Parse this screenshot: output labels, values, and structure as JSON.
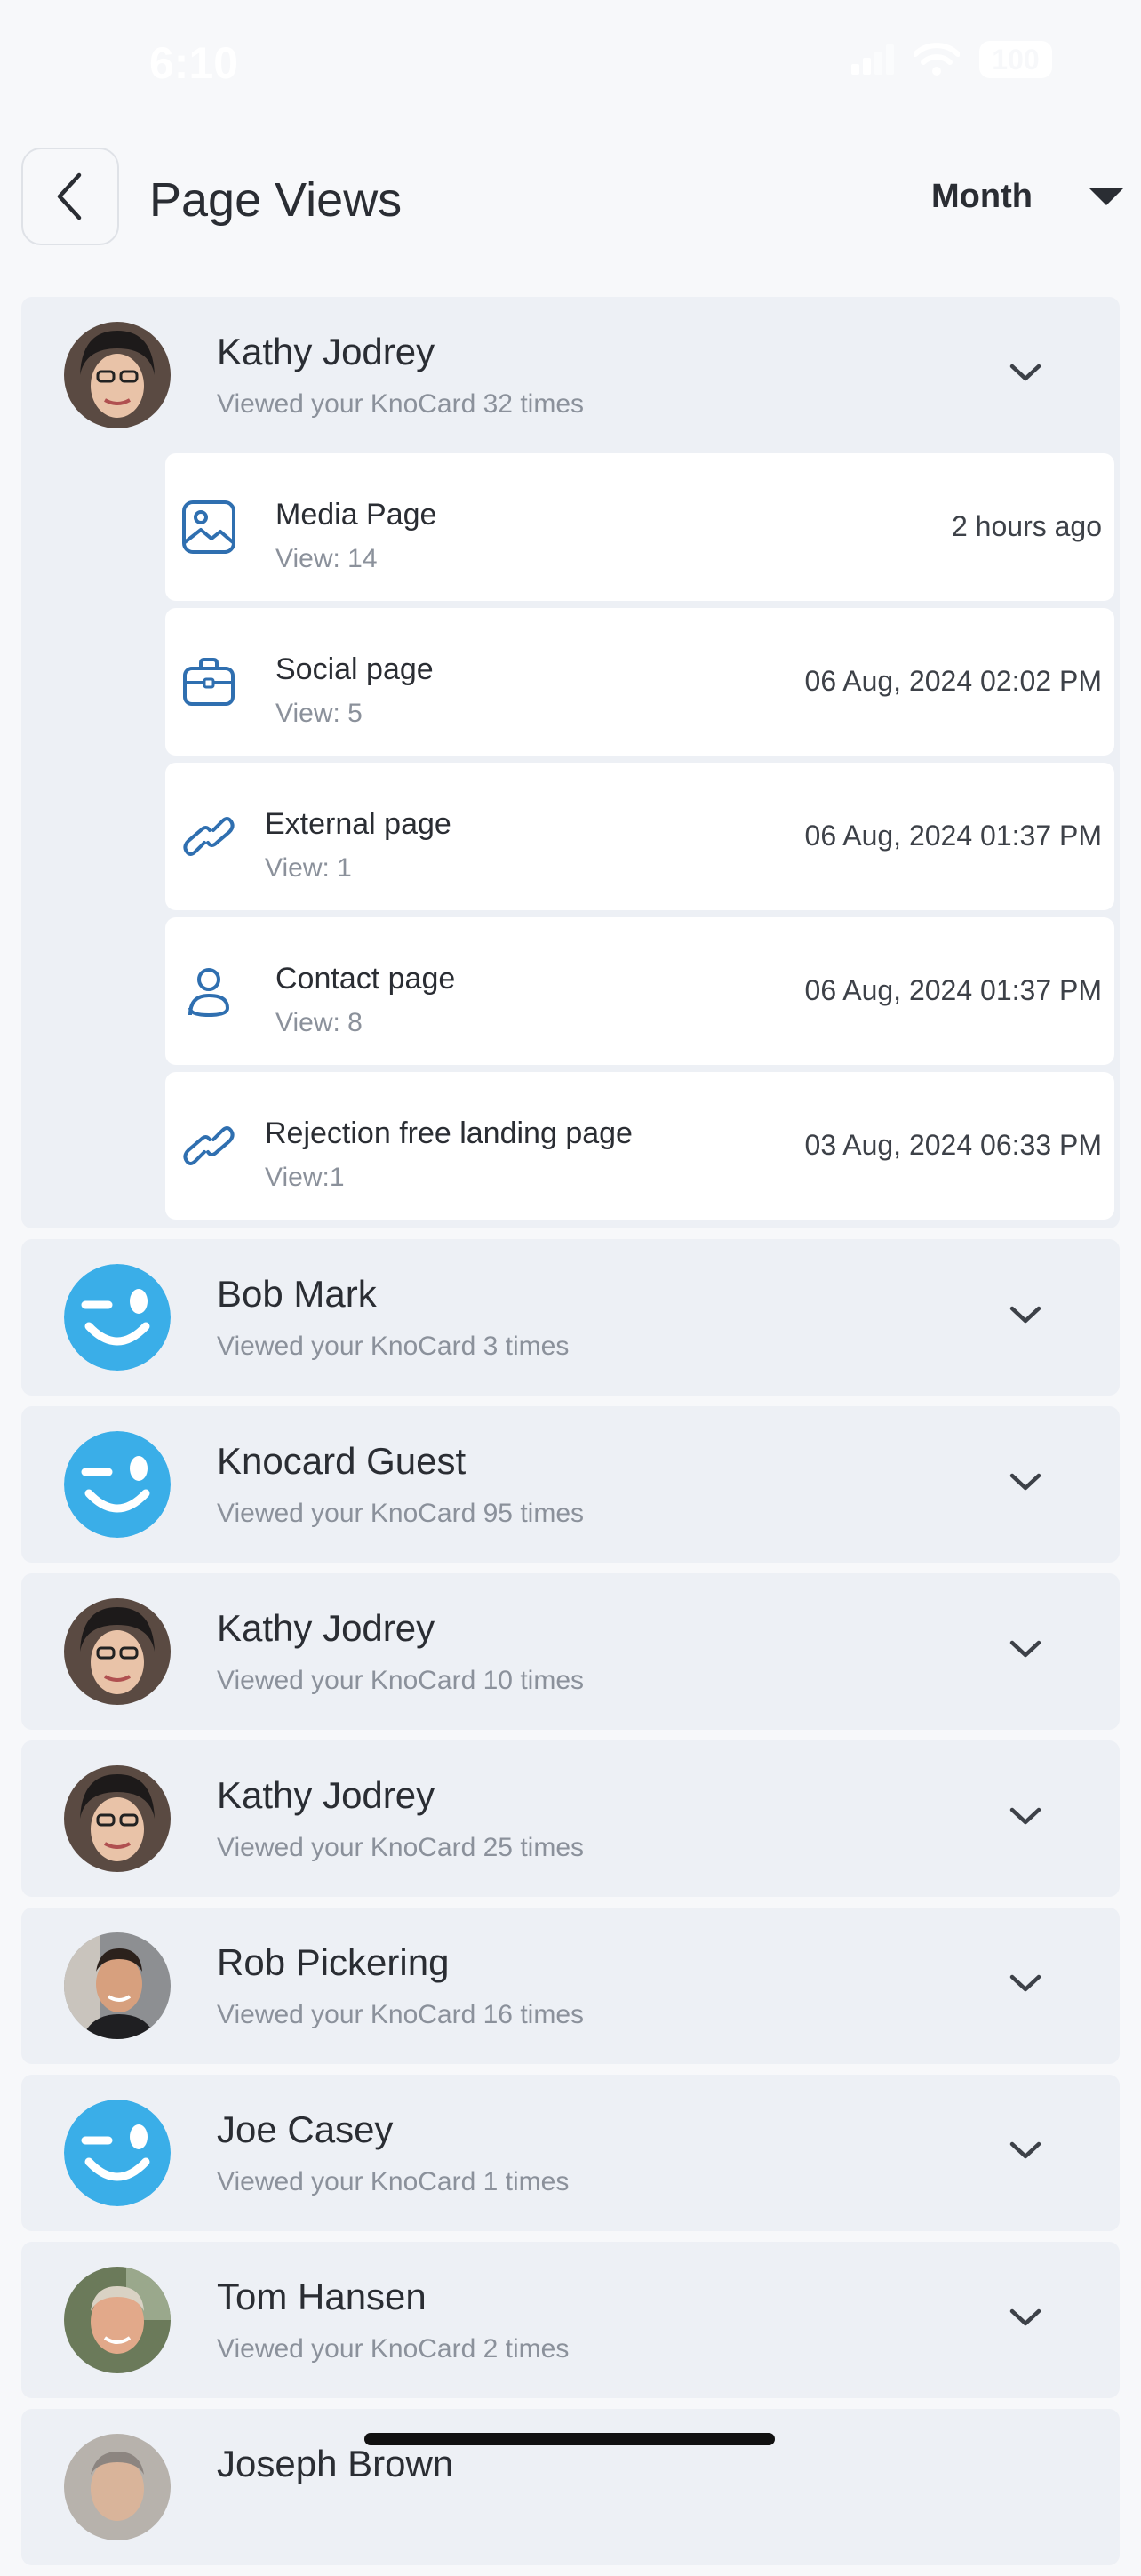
{
  "status_bar": {
    "time": "6:10",
    "battery": "100"
  },
  "header": {
    "title": "Page Views",
    "period": "Month"
  },
  "colors": {
    "accent": "#2f6fb0",
    "card_bg": "#edf0f5",
    "guest_avatar": "#3aaee8"
  },
  "viewers": [
    {
      "name": "Kathy Jodrey",
      "subtitle": "Viewed your KnoCard 32 times",
      "avatar": "photo-avatar-woman",
      "expanded": true,
      "pages": [
        {
          "title": "Media Page",
          "views": "View: 14",
          "time": "2 hours ago",
          "icon": "image-icon"
        },
        {
          "title": "Social page",
          "views": "View: 5",
          "time": "06 Aug, 2024 02:02 PM",
          "icon": "briefcase-icon"
        },
        {
          "title": "External page",
          "views": "View: 1",
          "time": "06 Aug, 2024 01:37 PM",
          "icon": "link-icon"
        },
        {
          "title": "Contact page",
          "views": "View: 8",
          "time": "06 Aug, 2024 01:37 PM",
          "icon": "person-icon"
        },
        {
          "title": "Rejection free landing page",
          "views": "View:1",
          "time": "03 Aug, 2024 06:33 PM",
          "icon": "link-icon"
        }
      ]
    },
    {
      "name": "Bob Mark",
      "subtitle": "Viewed your KnoCard 3 times",
      "avatar": "guest-avatar"
    },
    {
      "name": "Knocard Guest",
      "subtitle": "Viewed your KnoCard 95 times",
      "avatar": "guest-avatar"
    },
    {
      "name": "Kathy Jodrey",
      "subtitle": "Viewed your KnoCard 10 times",
      "avatar": "photo-avatar-woman"
    },
    {
      "name": "Kathy Jodrey",
      "subtitle": "Viewed your KnoCard 25 times",
      "avatar": "photo-avatar-woman"
    },
    {
      "name": "Rob Pickering",
      "subtitle": "Viewed your KnoCard 16 times",
      "avatar": "photo-avatar-man"
    },
    {
      "name": "Joe Casey",
      "subtitle": "Viewed your KnoCard 1 times",
      "avatar": "guest-avatar"
    },
    {
      "name": "Tom Hansen",
      "subtitle": "Viewed your KnoCard 2 times",
      "avatar": "photo-avatar-man-2"
    },
    {
      "name": "Joseph Brown",
      "subtitle": "",
      "avatar": "photo-avatar-man-3"
    }
  ]
}
